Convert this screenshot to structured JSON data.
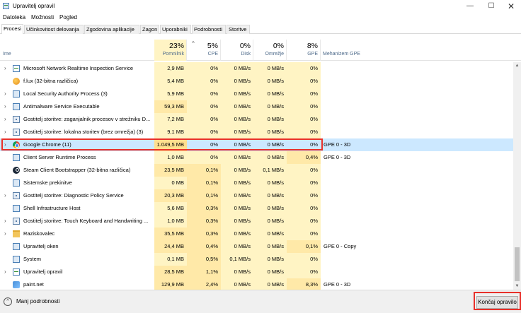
{
  "window": {
    "title": "Upravitelj opravil",
    "min": "—",
    "max": "☐",
    "close": "✕"
  },
  "menu": [
    "Datoteka",
    "Možnosti",
    "Pogled"
  ],
  "tabs": [
    "Procesi",
    "Učinkovitost delovanja",
    "Zgodovina aplikacije",
    "Zagon",
    "Uporabniki",
    "Podrobnosti",
    "Storitve"
  ],
  "active_tab": "Procesi",
  "columns": {
    "name": "Ime",
    "memory": {
      "pct": "23%",
      "label": "Pomnilnik"
    },
    "cpu": {
      "pct": "5%",
      "label": "CPE"
    },
    "disk": {
      "pct": "0%",
      "label": "Disk"
    },
    "network": {
      "pct": "0%",
      "label": "Omrežje"
    },
    "gpu": {
      "pct": "8%",
      "label": "GPE"
    },
    "gpu_engine": "Mehanizem GPE"
  },
  "processes": [
    {
      "expand": true,
      "icon": "monitor-icon",
      "name": "Microsoft Network Realtime Inspection Service",
      "memory": "2,9 MB",
      "cpu": "0%",
      "disk": "0 MB/s",
      "network": "0 MB/s",
      "gpu": "0%",
      "gpu_engine": ""
    },
    {
      "expand": false,
      "icon": "flux-icon",
      "name": "f.lux (32-bitna različica)",
      "memory": "5,4 MB",
      "cpu": "0%",
      "disk": "0 MB/s",
      "network": "0 MB/s",
      "gpu": "0%",
      "gpu_engine": ""
    },
    {
      "expand": true,
      "icon": "window-icon",
      "name": "Local Security Authority Process (3)",
      "memory": "5,9 MB",
      "cpu": "0%",
      "disk": "0 MB/s",
      "network": "0 MB/s",
      "gpu": "0%",
      "gpu_engine": ""
    },
    {
      "expand": true,
      "icon": "window-icon",
      "name": "Antimalware Service Executable",
      "memory": "59,3 MB",
      "cpu": "0%",
      "disk": "0 MB/s",
      "network": "0 MB/s",
      "gpu": "0%",
      "gpu_engine": ""
    },
    {
      "expand": true,
      "icon": "gear-icon",
      "name": "Gostitelj storitve: zaganjalnik procesov v strežniku D...",
      "memory": "7,2 MB",
      "cpu": "0%",
      "disk": "0 MB/s",
      "network": "0 MB/s",
      "gpu": "0%",
      "gpu_engine": ""
    },
    {
      "expand": true,
      "icon": "gear-icon",
      "name": "Gostitelj storitve: lokalna storitev (brez omrežja) (3)",
      "memory": "9,1 MB",
      "cpu": "0%",
      "disk": "0 MB/s",
      "network": "0 MB/s",
      "gpu": "0%",
      "gpu_engine": ""
    },
    {
      "expand": true,
      "icon": "chrome-icon",
      "name": "Google Chrome (11)",
      "memory": "1.049,5 MB",
      "cpu": "0%",
      "disk": "0 MB/s",
      "network": "0 MB/s",
      "gpu": "0%",
      "gpu_engine": "GPE 0 - 3D",
      "selected": true
    },
    {
      "expand": false,
      "icon": "window-icon",
      "name": "Client Server Runtime Process",
      "memory": "1,0 MB",
      "cpu": "0%",
      "disk": "0 MB/s",
      "network": "0 MB/s",
      "gpu": "0,4%",
      "gpu_engine": "GPE 0 - 3D"
    },
    {
      "expand": false,
      "icon": "steam-icon",
      "name": "Steam Client Bootstrapper (32-bitna različica)",
      "memory": "23,5 MB",
      "cpu": "0,1%",
      "disk": "0 MB/s",
      "network": "0,1 MB/s",
      "gpu": "0%",
      "gpu_engine": ""
    },
    {
      "expand": false,
      "icon": "window-icon",
      "name": "Sistemske prekinitve",
      "memory": "0 MB",
      "cpu": "0,1%",
      "disk": "0 MB/s",
      "network": "0 MB/s",
      "gpu": "0%",
      "gpu_engine": ""
    },
    {
      "expand": true,
      "icon": "gear-icon",
      "name": "Gostitelj storitve: Diagnostic Policy Service",
      "memory": "20,3 MB",
      "cpu": "0,1%",
      "disk": "0 MB/s",
      "network": "0 MB/s",
      "gpu": "0%",
      "gpu_engine": ""
    },
    {
      "expand": false,
      "icon": "window-icon",
      "name": "Shell Infrastructure Host",
      "memory": "5,6 MB",
      "cpu": "0,3%",
      "disk": "0 MB/s",
      "network": "0 MB/s",
      "gpu": "0%",
      "gpu_engine": ""
    },
    {
      "expand": true,
      "icon": "gear-icon",
      "name": "Gostitelj storitve: Touch Keyboard and Handwriting ...",
      "memory": "1,0 MB",
      "cpu": "0,3%",
      "disk": "0 MB/s",
      "network": "0 MB/s",
      "gpu": "0%",
      "gpu_engine": ""
    },
    {
      "expand": true,
      "icon": "folder-icon",
      "name": "Raziskovalec",
      "memory": "35,5 MB",
      "cpu": "0,3%",
      "disk": "0 MB/s",
      "network": "0 MB/s",
      "gpu": "0%",
      "gpu_engine": ""
    },
    {
      "expand": false,
      "icon": "window-icon",
      "name": "Upravitelj oken",
      "memory": "24,4 MB",
      "cpu": "0,4%",
      "disk": "0 MB/s",
      "network": "0 MB/s",
      "gpu": "0,1%",
      "gpu_engine": "GPE 0 - Copy"
    },
    {
      "expand": false,
      "icon": "window-icon",
      "name": "System",
      "memory": "0,1 MB",
      "cpu": "0,5%",
      "disk": "0,1 MB/s",
      "network": "0 MB/s",
      "gpu": "0%",
      "gpu_engine": ""
    },
    {
      "expand": true,
      "icon": "monitor-icon",
      "name": "Upravitelj opravil",
      "memory": "28,5 MB",
      "cpu": "1,1%",
      "disk": "0 MB/s",
      "network": "0 MB/s",
      "gpu": "0%",
      "gpu_engine": ""
    },
    {
      "expand": false,
      "icon": "paint-icon",
      "name": "paint.net",
      "memory": "129,9 MB",
      "cpu": "2,4%",
      "disk": "0 MB/s",
      "network": "0 MB/s",
      "gpu": "8,3%",
      "gpu_engine": "GPE 0 - 3D"
    }
  ],
  "footer": {
    "fewer_details": "Manj podrobnosti",
    "end_task": "Končaj opravilo"
  },
  "colors": {
    "highlight": "#e8302a",
    "selected": "#cce8ff",
    "heat_low": "#fff4c4",
    "heat_mid": "#ffe9a8",
    "heat_high": "#ffdf8e"
  }
}
